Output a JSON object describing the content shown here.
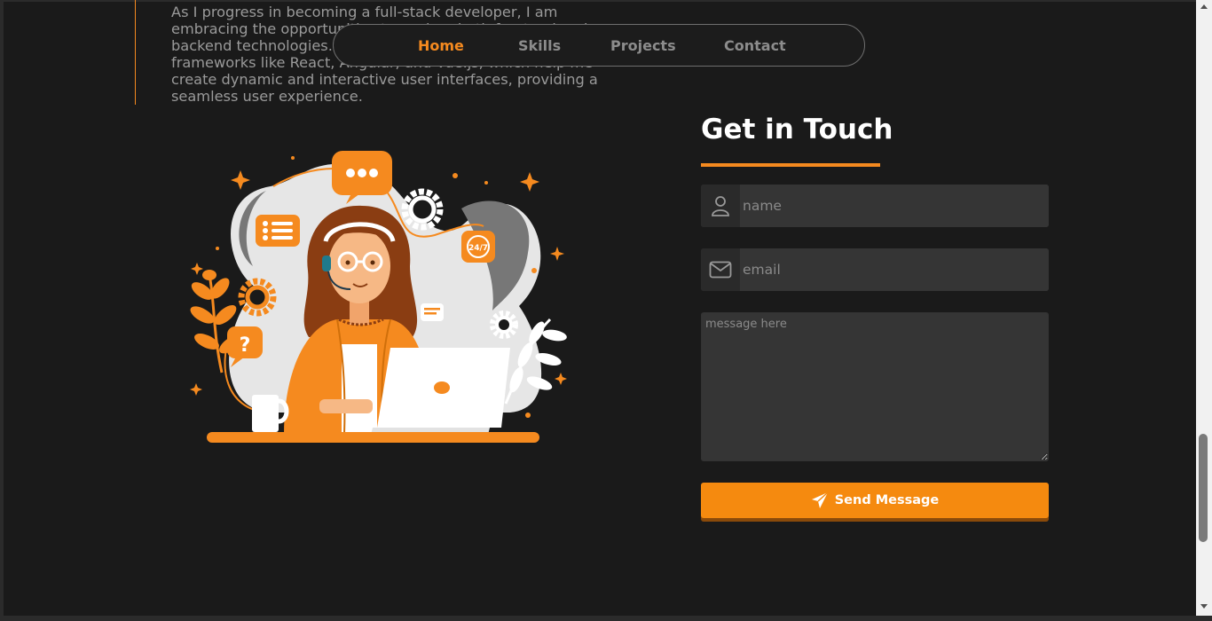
{
  "about": {
    "lines": [
      "As I progress in becoming a full-stack developer, I am",
      "embracing the opportunities to explore both frontend and",
      "backend technologies. I have gained experience with",
      "frameworks like React, Angular, and Vue.js, which help me",
      "create dynamic and interactive user interfaces, providing a",
      "seamless user experience."
    ]
  },
  "nav": {
    "items": [
      {
        "label": "Home",
        "active": true
      },
      {
        "label": "Skills",
        "active": false
      },
      {
        "label": "Projects",
        "active": false
      },
      {
        "label": "Contact",
        "active": false
      }
    ]
  },
  "illustration": {
    "badge_text": "24/7",
    "question_mark": "?"
  },
  "contact": {
    "title": "Get in Touch",
    "name_placeholder": "name",
    "email_placeholder": "email",
    "message_placeholder": "message here",
    "send_label": "Send Message"
  },
  "icons": {
    "name_field": "user-icon",
    "email_field": "mail-icon",
    "send_button": "paper-plane-icon"
  },
  "colors": {
    "background": "#1a1a1a",
    "accent": "#f58a1f",
    "field_bg": "#353535",
    "nav_text": "#8c8c8c",
    "title_text": "#ffffff"
  }
}
